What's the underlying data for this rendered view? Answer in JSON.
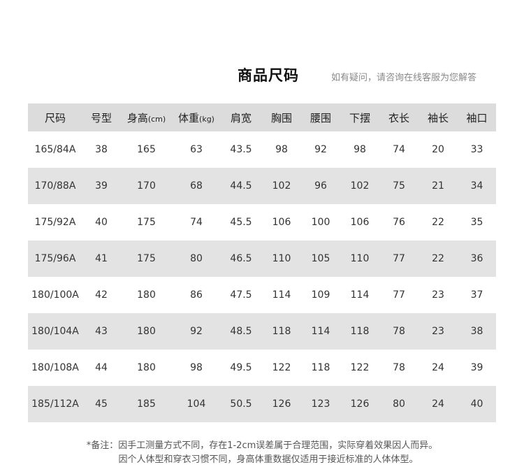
{
  "title": "商品尺码",
  "subtitle": "如有疑问，请咨询在线客服为您解答",
  "table": {
    "headers": [
      {
        "label": "尺码",
        "unit": ""
      },
      {
        "label": "号型",
        "unit": ""
      },
      {
        "label": "身高",
        "unit": "(cm)"
      },
      {
        "label": "体重",
        "unit": "(kg)"
      },
      {
        "label": "肩宽",
        "unit": ""
      },
      {
        "label": "胸围",
        "unit": ""
      },
      {
        "label": "腰围",
        "unit": ""
      },
      {
        "label": "下摆",
        "unit": ""
      },
      {
        "label": "衣长",
        "unit": ""
      },
      {
        "label": "袖长",
        "unit": ""
      },
      {
        "label": "袖口",
        "unit": ""
      }
    ],
    "rows": [
      [
        "165/84A",
        "38",
        "165",
        "63",
        "43.5",
        "98",
        "92",
        "98",
        "74",
        "20",
        "33"
      ],
      [
        "170/88A",
        "39",
        "170",
        "68",
        "44.5",
        "102",
        "96",
        "102",
        "75",
        "21",
        "34"
      ],
      [
        "175/92A",
        "40",
        "175",
        "74",
        "45.5",
        "106",
        "100",
        "106",
        "76",
        "22",
        "35"
      ],
      [
        "175/96A",
        "41",
        "175",
        "80",
        "46.5",
        "110",
        "105",
        "110",
        "77",
        "22",
        "36"
      ],
      [
        "180/100A",
        "42",
        "180",
        "86",
        "47.5",
        "114",
        "109",
        "114",
        "77",
        "23",
        "37"
      ],
      [
        "180/104A",
        "43",
        "180",
        "92",
        "48.5",
        "118",
        "114",
        "118",
        "78",
        "23",
        "38"
      ],
      [
        "180/108A",
        "44",
        "180",
        "98",
        "49.5",
        "122",
        "118",
        "122",
        "78",
        "24",
        "39"
      ],
      [
        "185/112A",
        "45",
        "185",
        "104",
        "50.5",
        "126",
        "123",
        "126",
        "80",
        "24",
        "40"
      ]
    ]
  },
  "notes": {
    "line1": "*备注：因手工测量方式不同，存在1-2cm误差属于合理范围，实际穿着效果因人而异。",
    "line2": "因个人体型和穿衣习惯不同，身高体重数据仅适用于接近标准的人体体型。"
  }
}
